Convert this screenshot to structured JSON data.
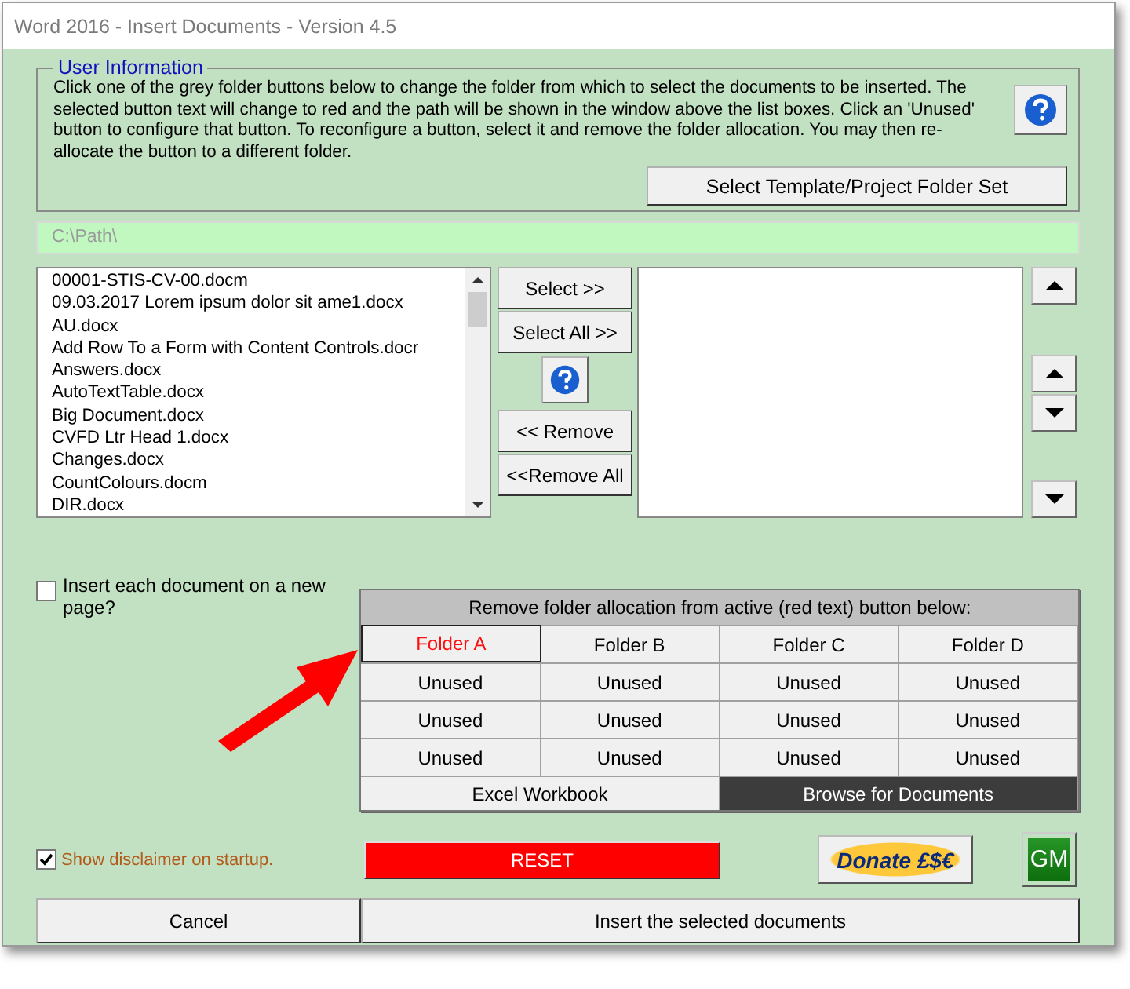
{
  "window": {
    "title": "Word 2016 - Insert Documents - Version 4.5"
  },
  "user_information": {
    "legend": "User Information",
    "text": "Click one of the grey folder buttons below to change the folder from which to select the documents to be inserted. The selected button text will change to red and the path will be shown in the window above the list boxes. Click an 'Unused' button to configure that button. To reconfigure a button, select it and remove the folder allocation. You may then re-allocate the button to a different folder.",
    "button": "Select Template/Project Folder Set"
  },
  "path_field": {
    "value": "C:\\Path\\"
  },
  "documents": [
    "00001-STIS-CV-00.docm",
    "09.03.2017 Lorem ipsum dolor sit ame1.docx",
    "AU.docx",
    "Add Row To a Form with Content Controls.docr",
    "Answers.docx",
    "AutoTextTable.docx",
    "Big Document.docx",
    "CVFD Ltr Head 1.docx",
    "Changes.docx",
    "CountColours.docm",
    "DIR.docx"
  ],
  "transfer_buttons": [
    {
      "label": "Select >>",
      "kind": "button"
    },
    {
      "label": "Select All >>",
      "kind": "button"
    },
    {
      "kind": "help"
    },
    {
      "label": "<< Remove",
      "kind": "button"
    },
    {
      "label": "<<Remove All",
      "kind": "button"
    }
  ],
  "new_page_checkbox": {
    "label": "Insert each document on a new page?",
    "checked": false
  },
  "folder_panel": {
    "header": "Remove folder allocation from active (red text) button below:",
    "folders": [
      {
        "label": "Folder A",
        "selected": true
      },
      {
        "label": "Folder B",
        "selected": false
      },
      {
        "label": "Folder C",
        "selected": false
      },
      {
        "label": "Folder D",
        "selected": false
      },
      {
        "label": "Unused",
        "selected": false
      },
      {
        "label": "Unused",
        "selected": false
      },
      {
        "label": "Unused",
        "selected": false
      },
      {
        "label": "Unused",
        "selected": false
      },
      {
        "label": "Unused",
        "selected": false
      },
      {
        "label": "Unused",
        "selected": false
      },
      {
        "label": "Unused",
        "selected": false
      },
      {
        "label": "Unused",
        "selected": false
      },
      {
        "label": "Unused",
        "selected": false
      },
      {
        "label": "Unused",
        "selected": false
      },
      {
        "label": "Unused",
        "selected": false
      },
      {
        "label": "Unused",
        "selected": false
      }
    ],
    "buttons": [
      {
        "label": "Excel Workbook",
        "kind": "light"
      },
      {
        "label": "Browse for Documents",
        "kind": "dark"
      }
    ]
  },
  "disclaimer_checkbox": {
    "label": "Show disclaimer on startup.",
    "checked": true
  },
  "reset_button": "RESET",
  "donate_button": "Donate £$€",
  "gm_button": "GM",
  "footer_buttons": [
    "Cancel",
    "Insert the selected documents"
  ]
}
